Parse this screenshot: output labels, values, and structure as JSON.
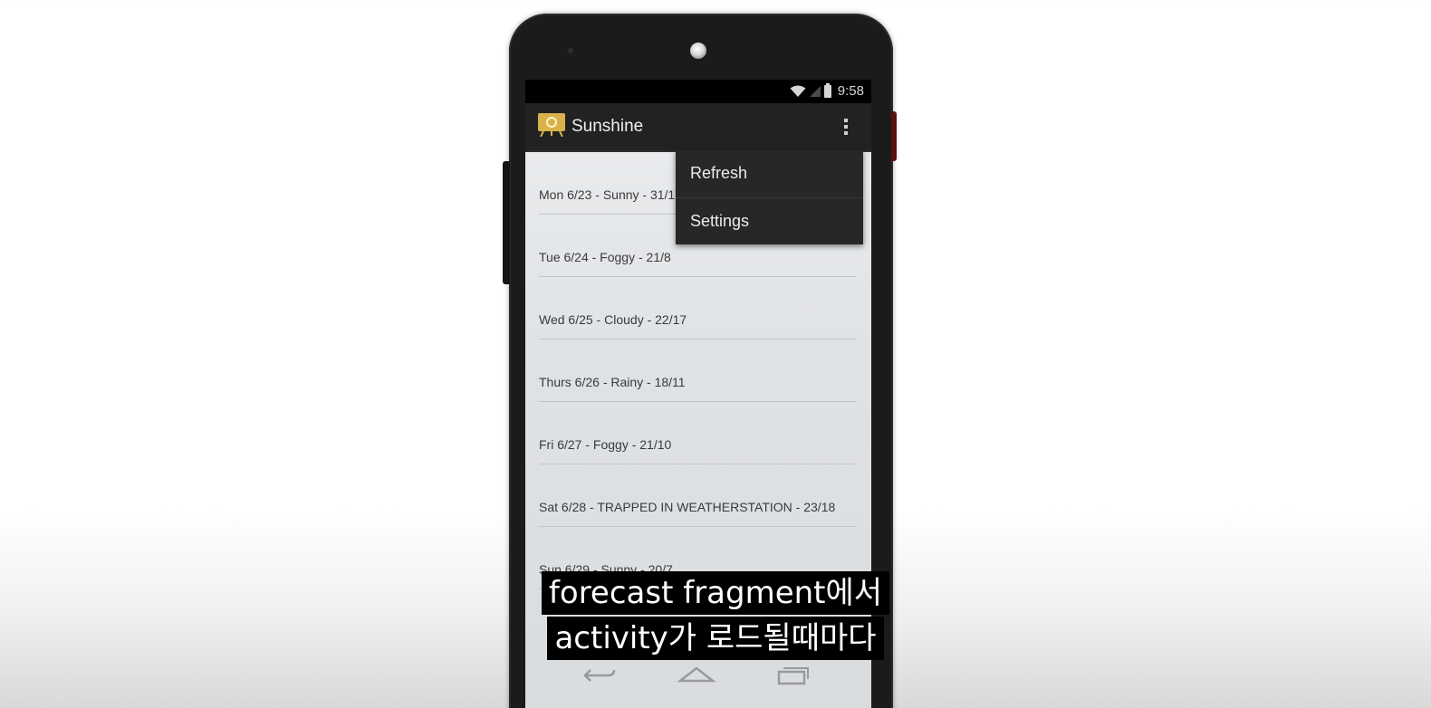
{
  "status_bar": {
    "time": "9:58",
    "icons": [
      "wifi-icon",
      "signal-icon",
      "battery-icon"
    ]
  },
  "action_bar": {
    "app_icon": "sunshine-app-icon",
    "title": "Sunshine",
    "overflow_icon": "overflow-menu-icon"
  },
  "overflow_menu": {
    "items": [
      {
        "label": "Refresh"
      },
      {
        "label": "Settings"
      }
    ]
  },
  "forecast": {
    "items": [
      {
        "text": "Mon 6/23  - Sunny - 31/17"
      },
      {
        "text": "Tue 6/24 - Foggy - 21/8"
      },
      {
        "text": "Wed 6/25 - Cloudy - 22/17"
      },
      {
        "text": "Thurs 6/26 - Rainy - 18/11"
      },
      {
        "text": "Fri 6/27 - Foggy - 21/10"
      },
      {
        "text": "Sat 6/28 - TRAPPED IN WEATHERSTATION - 23/18"
      },
      {
        "text": "Sun 6/29 - Sunny - 20/7"
      }
    ]
  },
  "nav_bar": {
    "icons": [
      "back-icon",
      "home-icon",
      "recent-apps-icon"
    ]
  },
  "subtitles": {
    "line1": "forecast fragment에서",
    "line2": "activity가 로드될때마다"
  },
  "colors": {
    "action_bar": "#222222",
    "list_background": "#e2e5e8",
    "menu_background": "#272727",
    "app_icon": "#d9b24a"
  }
}
